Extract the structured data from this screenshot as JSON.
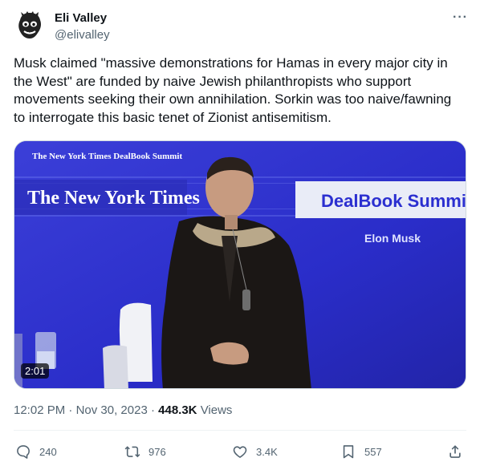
{
  "author": {
    "name": "Eli Valley",
    "handle": "@elivalley",
    "more_label": "···"
  },
  "tweet": {
    "text": "Musk claimed \"massive demonstrations for Hamas in every major city in the West\" are funded by naive Jewish philanthropists who support movements seeking their own annihilation. Sorkin was too naive/fawning to interrogate this basic tenet of Zionist antisemitism."
  },
  "media": {
    "small_banner": "The New York Times DealBook Summit",
    "nyt_logo": "The New York Times",
    "event_title": "DealBook Summit",
    "speaker_name": "Elon Musk",
    "timecode": "2:01"
  },
  "meta": {
    "time": "12:02 PM",
    "separator": "·",
    "date": "Nov 30, 2023",
    "views_count": "448.3K",
    "views_label": "Views"
  },
  "actions": {
    "replies": "240",
    "reposts": "976",
    "likes": "3.4K",
    "bookmarks": "557"
  },
  "icons": [
    "avatar",
    "more-icon",
    "reply-icon",
    "repost-icon",
    "like-icon",
    "bookmark-icon",
    "share-icon"
  ]
}
